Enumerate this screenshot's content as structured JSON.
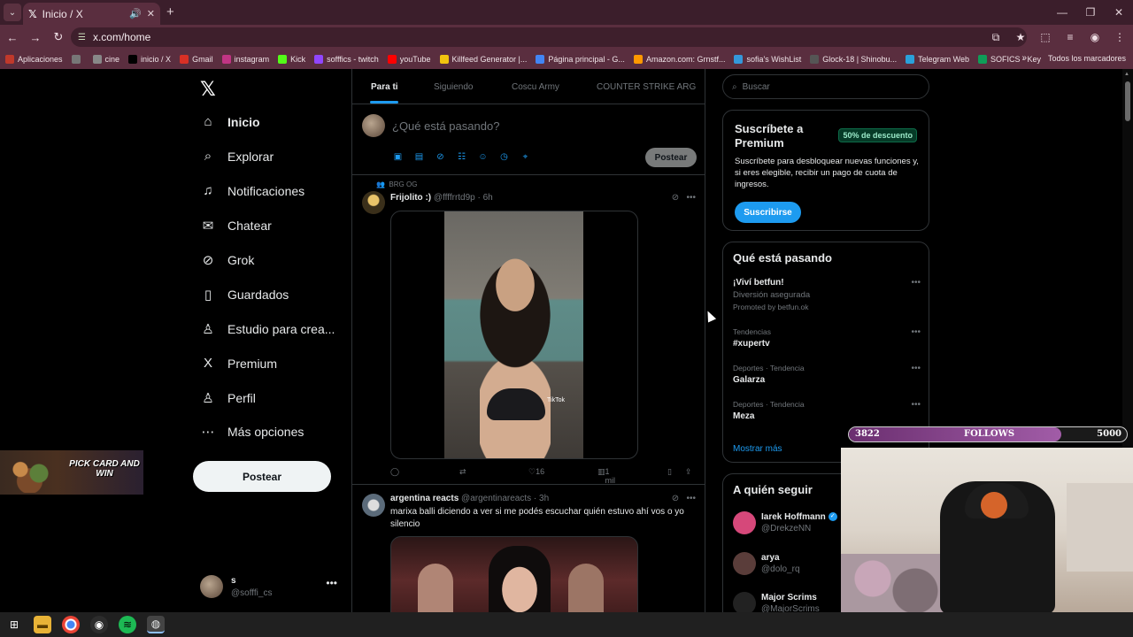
{
  "browser": {
    "tab_title": "Inicio / X",
    "url": "x.com/home",
    "bookmarks": [
      {
        "label": "Aplicaciones",
        "color": "#c0392b"
      },
      {
        "label": "",
        "color": "#777"
      },
      {
        "label": "cine",
        "color": "#888"
      },
      {
        "label": "inicio / X",
        "color": "#000"
      },
      {
        "label": "Gmail",
        "color": "#d93025"
      },
      {
        "label": "instagram",
        "color": "#c13584"
      },
      {
        "label": "Kick",
        "color": "#53fc18"
      },
      {
        "label": "sofffics - twitch",
        "color": "#9146ff"
      },
      {
        "label": "youTube",
        "color": "#ff0000"
      },
      {
        "label": "Killfeed Generator |...",
        "color": "#f1c40f"
      },
      {
        "label": "Página principal - G...",
        "color": "#4285f4"
      },
      {
        "label": "Amazon.com: Grnstf...",
        "color": "#ff9900"
      },
      {
        "label": "sofia's WishList",
        "color": "#3498db"
      },
      {
        "label": "Glock-18 | Shinobu...",
        "color": "#555"
      },
      {
        "label": "Telegram Web",
        "color": "#2aa1da"
      },
      {
        "label": "SOFICS - Key",
        "color": "#0f9d58"
      }
    ],
    "all_bookmarks": "Todos los marcadores"
  },
  "nav": {
    "items": [
      {
        "label": "Inicio",
        "icon": "⌂",
        "name": "home"
      },
      {
        "label": "Explorar",
        "icon": "⌕",
        "name": "explore"
      },
      {
        "label": "Notificaciones",
        "icon": "♫",
        "name": "notifications"
      },
      {
        "label": "Chatear",
        "icon": "✉",
        "name": "chat"
      },
      {
        "label": "Grok",
        "icon": "⊘",
        "name": "grok"
      },
      {
        "label": "Guardados",
        "icon": "▯",
        "name": "bookmarks"
      },
      {
        "label": "Estudio para crea...",
        "icon": "♙",
        "name": "creator-studio"
      },
      {
        "label": "Premium",
        "icon": "X",
        "name": "premium"
      },
      {
        "label": "Perfil",
        "icon": "♙",
        "name": "profile"
      },
      {
        "label": "Más opciones",
        "icon": "⋯",
        "name": "more"
      }
    ],
    "post_label": "Postear",
    "account_name": "s",
    "account_handle": "@sofffi_cs"
  },
  "ad": {
    "text": "PICK CARD AND WIN"
  },
  "feed": {
    "tabs": [
      "Para ti",
      "Siguiendo",
      "Coscu Army",
      "COUNTER STRIKE ARG"
    ],
    "compose_placeholder": "¿Qué está pasando?",
    "compose_button": "Postear",
    "tweets": [
      {
        "context": "BRG OG",
        "name": "Frijolito :)",
        "handle": "@ffffrrtd9p · 6h",
        "video_watermark": "TikTok",
        "likes": "16",
        "views": "1 mil"
      },
      {
        "name": "argentina reacts",
        "handle": "@argentinareacts · 3h",
        "text": "marixa balli diciendo a ver si me podés escuchar quién estuvo ahí vos o yo silencio"
      }
    ]
  },
  "sidebar": {
    "search_placeholder": "Buscar",
    "premium": {
      "title": "Suscríbete a Premium",
      "badge": "50% de descuento",
      "desc": "Suscríbete para desbloquear nuevas funciones y, si eres elegible, recibir un pago de cuota de ingresos.",
      "button": "Suscribirse"
    },
    "trends": {
      "title": "Qué está pasando",
      "items": [
        {
          "l1": "",
          "l2": "¡Viví betfun!",
          "l3": "Diversión asegurada",
          "l4": "Promoted by betfun.ok"
        },
        {
          "l1": "Tendencias",
          "l2": "#xupertv"
        },
        {
          "l1": "Deportes · Tendencia",
          "l2": "Galarza"
        },
        {
          "l1": "Deportes · Tendencia",
          "l2": "Meza"
        }
      ],
      "more": "Mostrar más"
    },
    "who": {
      "title": "A quién seguir",
      "items": [
        {
          "name": "Iarek Hoffmann",
          "handle": "@DrekzeNN",
          "color": "#d6487a"
        },
        {
          "name": "arya",
          "handle": "@dolo_rq",
          "color": "#5a3d3a"
        },
        {
          "name": "Major Scrims",
          "handle": "@MajorScrims_",
          "color": "#222"
        }
      ]
    }
  },
  "follows_goal": {
    "current": "3822",
    "label": "FOLLOWS",
    "target": "5000",
    "progress": 0.764
  }
}
